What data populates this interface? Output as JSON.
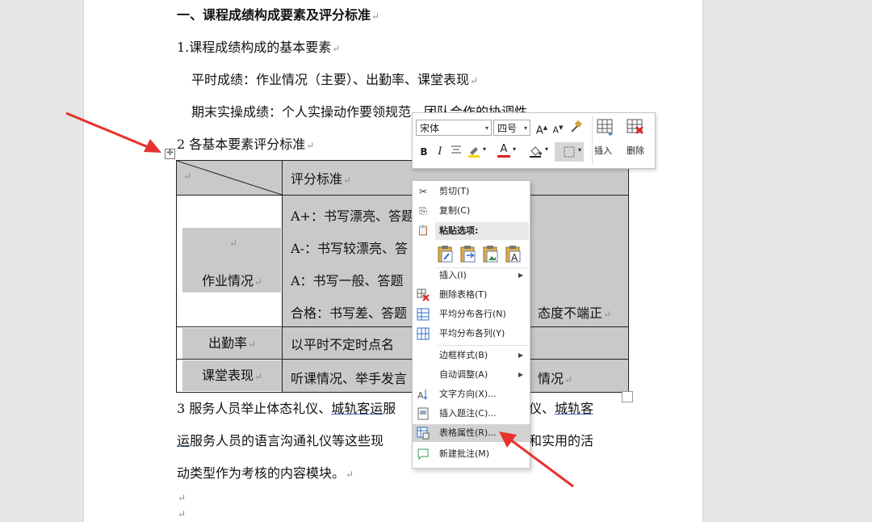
{
  "doc": {
    "heading": "一、课程成绩构成要素及评分标准",
    "section1_title": "1.课程成绩构成的基本要素",
    "section1_line1": "平时成绩：作业情况（主要）、出勤率、课堂表现",
    "section1_line2": "期末实操成绩：个人实操动作要领规范、团队合作的协调性",
    "section2_title": "2 各基本要素评分标准",
    "table": {
      "header_right": "评分标准",
      "homework_label": "作业情况",
      "homework_rows": [
        "A+：书写漂亮、答题",
        "A-：书写较漂亮、答",
        "A：书写一般、答题",
        "合格：书写差、答题"
      ],
      "homework_row_tail": "态度不端正",
      "attendance_label": "出勤率",
      "attendance_text": "以平时不定时点名",
      "class_label": "课堂表现",
      "class_text": "听课情况、举手发言",
      "class_text_tail": "情况"
    },
    "para3_line1_a": "3 服务人员举止体态礼仪、",
    "para3_line1_b": "城轨客运",
    "para3_line1_c": "服",
    "para3_line1_d": "仪、",
    "para3_line1_e": "城轨客",
    "para3_line2_a": "运",
    "para3_line2_b": "服务人员的语言沟通礼仪等这些现",
    "para3_line2_c": "和实用的活",
    "para3_line3": "动类型作为考核的内容模块。",
    "para_mark": "↵"
  },
  "mini_toolbar": {
    "font_name": "宋体",
    "font_size": "四号",
    "insert_label": "插入",
    "delete_label": "删除"
  },
  "context_menu": {
    "cut": "剪切(T)",
    "copy": "复制(C)",
    "paste_options": "粘贴选项:",
    "insert": "插入(I)",
    "delete_table": "删除表格(T)",
    "distribute_rows": "平均分布各行(N)",
    "distribute_cols": "平均分布各列(Y)",
    "border_styles": "边框样式(B)",
    "autofit": "自动调整(A)",
    "text_direction": "文字方向(X)...",
    "insert_caption": "插入题注(C)...",
    "table_properties": "表格属性(R)...",
    "new_comment": "新建批注(M)"
  },
  "colors": {
    "highlight_yellow": "#f5d90a",
    "font_red": "#e02020",
    "arrow_red": "#e8322e",
    "table_shade": "#c9c9c9"
  }
}
